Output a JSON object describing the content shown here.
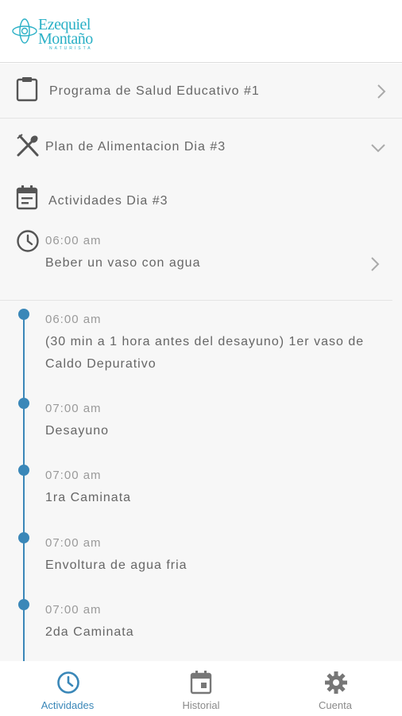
{
  "header": {
    "logo_line1": "Ezequiel",
    "logo_line2": "Montaño",
    "logo_sub": "NATURISTA"
  },
  "colors": {
    "accent": "#3a87b8",
    "logo": "#2ab0c6",
    "muted": "#9a9a9a",
    "text": "#666666"
  },
  "menu": {
    "program_label": "Programa de Salud Educativo #1",
    "program_icon": "clipboard-icon",
    "plan_label": "Plan de Alimentacion Dia #3",
    "plan_icon": "utensils-icon",
    "activities_label": "Actividades Dia #3",
    "activities_icon": "calendar-icon"
  },
  "first_activity": {
    "time": "06:00 am",
    "description": "Beber un vaso con agua",
    "icon": "clock-icon"
  },
  "timeline": [
    {
      "time": "06:00 am",
      "description": "(30 min a 1 hora antes del desayuno) 1er vaso de Caldo Depurativo"
    },
    {
      "time": "07:00 am",
      "description": "Desayuno"
    },
    {
      "time": "07:00 am",
      "description": "1ra Caminata"
    },
    {
      "time": "07:00 am",
      "description": "Envoltura de agua fria"
    },
    {
      "time": "07:00 am",
      "description": "2da Caminata"
    }
  ],
  "tabs": [
    {
      "label": "Actividades",
      "icon": "clock-icon",
      "active": true
    },
    {
      "label": "Historial",
      "icon": "calendar-icon",
      "active": false
    },
    {
      "label": "Cuenta",
      "icon": "gear-icon",
      "active": false
    }
  ]
}
